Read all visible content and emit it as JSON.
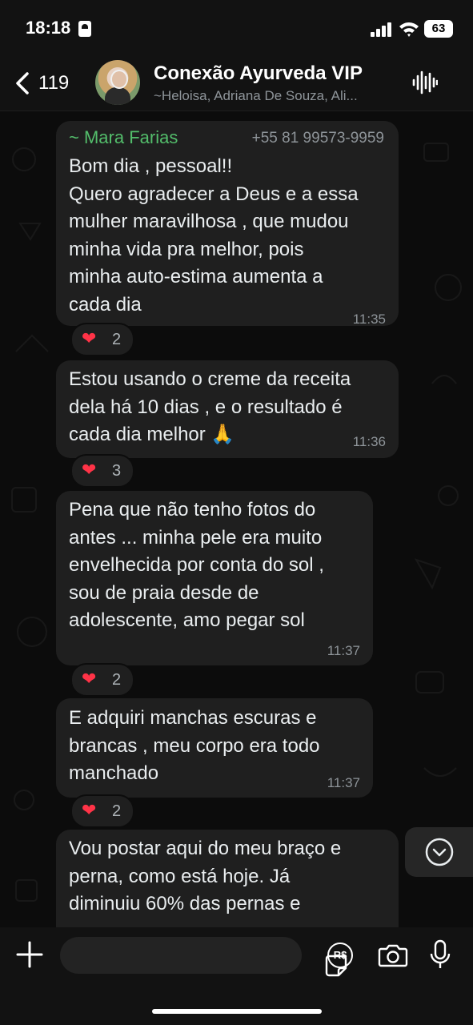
{
  "status_bar": {
    "time": "18:18",
    "battery": "63"
  },
  "header": {
    "back_count": "119",
    "title": "Conexão Ayurveda VIP",
    "subtitle": "~Heloisa, Adriana De Souza, Ali..."
  },
  "messages": [
    {
      "sender": "~ Mara Farias",
      "phone": "+55 81 99573-9959",
      "text": "Bom dia , pessoal!!\nQuero agradecer a Deus e a essa\nmulher maravilhosa , que mudou\nminha vida pra melhor, pois\nminha auto-estima aumenta a\ncada dia",
      "time": "11:35",
      "reaction": {
        "emoji": "❤",
        "count": "2"
      }
    },
    {
      "text": "Estou usando o creme da receita\ndela há 10 dias , e o resultado é\ncada dia melhor 🙏",
      "time": "11:36",
      "reaction": {
        "emoji": "❤",
        "count": "3"
      }
    },
    {
      "text": "Pena que não tenho fotos do\nantes ... minha pele era muito\nenvelhecida por conta do sol ,\nsou de praia desde de\nadolescente, amo pegar sol",
      "time": "11:37",
      "reaction": {
        "emoji": "❤",
        "count": "2"
      }
    },
    {
      "text": "E adquiri manchas escuras e\nbrancas , meu corpo era todo\nmanchado",
      "time": "11:37",
      "reaction": {
        "emoji": "❤",
        "count": "2"
      }
    },
    {
      "text": "Vou postar aqui do meu braço e\nperna, como está hoje. Já\ndiminuiu 60% das pernas e"
    }
  ],
  "input_bar": {
    "pix_label": "R$"
  },
  "icons": [
    "back-chevron-icon",
    "audio-wave-icon",
    "plus-icon",
    "sticker-icon",
    "pix-icon",
    "camera-icon",
    "microphone-icon",
    "chevron-down-icon",
    "heart-icon"
  ],
  "colors": {
    "background": "#0c0c0c",
    "bubble": "#1f1f1f",
    "sender": "#53bd6b",
    "heart": "#ff3347"
  }
}
